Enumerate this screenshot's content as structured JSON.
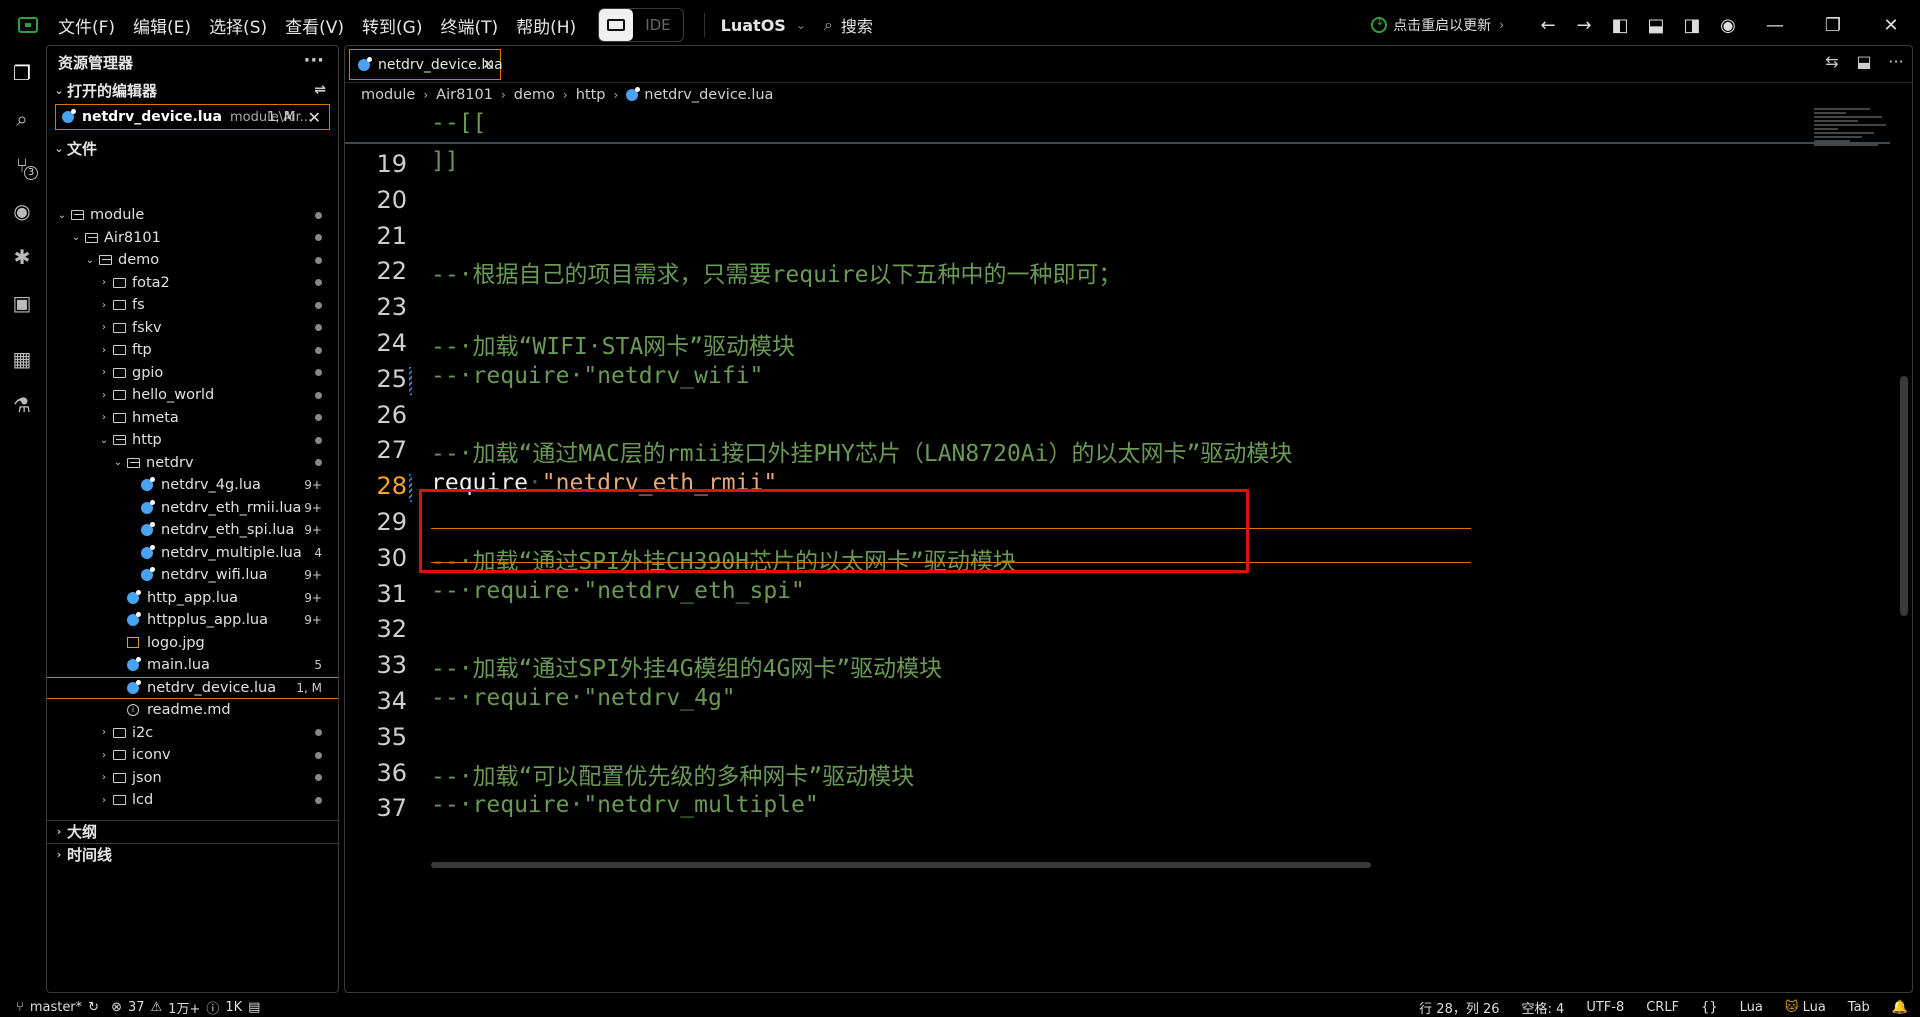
{
  "menu": [
    "文件(F)",
    "编辑(E)",
    "选择(S)",
    "查看(V)",
    "转到(G)",
    "终端(T)",
    "帮助(H)"
  ],
  "ide_label": "IDE",
  "product": "LuatOS",
  "search_label": "搜索",
  "update_label": "点击重启以更新",
  "sidebar": {
    "title": "资源管理器",
    "open_editors": "打开的编辑器",
    "open_file": {
      "name": "netdrv_device.lua",
      "path": "module\\Air...",
      "status": "1, M"
    },
    "files_header": "文件",
    "outline": "大纲",
    "timeline": "时间线"
  },
  "tree": [
    {
      "label": "module",
      "depth": 0,
      "type": "folder",
      "open": true,
      "mark": "dot"
    },
    {
      "label": "Air8101",
      "depth": 1,
      "type": "folder",
      "open": true,
      "mark": "dot"
    },
    {
      "label": "demo",
      "depth": 2,
      "type": "folder",
      "open": true,
      "mark": "dot"
    },
    {
      "label": "fota2",
      "depth": 3,
      "type": "folder",
      "open": false,
      "mark": "dot"
    },
    {
      "label": "fs",
      "depth": 3,
      "type": "folder",
      "open": false,
      "mark": "dot"
    },
    {
      "label": "fskv",
      "depth": 3,
      "type": "folder",
      "open": false,
      "mark": "dot"
    },
    {
      "label": "ftp",
      "depth": 3,
      "type": "folder",
      "open": false,
      "mark": "dot"
    },
    {
      "label": "gpio",
      "depth": 3,
      "type": "folder",
      "open": false,
      "mark": "dot"
    },
    {
      "label": "hello_world",
      "depth": 3,
      "type": "folder",
      "open": false,
      "mark": "dot"
    },
    {
      "label": "hmeta",
      "depth": 3,
      "type": "folder",
      "open": false,
      "mark": "dot"
    },
    {
      "label": "http",
      "depth": 3,
      "type": "folder",
      "open": true,
      "mark": "dot"
    },
    {
      "label": "netdrv",
      "depth": 4,
      "type": "folder",
      "open": true,
      "mark": "dot"
    },
    {
      "label": "netdrv_4g.lua",
      "depth": 5,
      "type": "lua",
      "mark": "9+"
    },
    {
      "label": "netdrv_eth_rmii.lua",
      "depth": 5,
      "type": "lua",
      "mark": "9+"
    },
    {
      "label": "netdrv_eth_spi.lua",
      "depth": 5,
      "type": "lua",
      "mark": "9+"
    },
    {
      "label": "netdrv_multiple.lua",
      "depth": 5,
      "type": "lua",
      "mark": "4"
    },
    {
      "label": "netdrv_wifi.lua",
      "depth": 5,
      "type": "lua",
      "mark": "9+"
    },
    {
      "label": "http_app.lua",
      "depth": 4,
      "type": "lua",
      "mark": "9+"
    },
    {
      "label": "httpplus_app.lua",
      "depth": 4,
      "type": "lua",
      "mark": "9+"
    },
    {
      "label": "logo.jpg",
      "depth": 4,
      "type": "img",
      "mark": ""
    },
    {
      "label": "main.lua",
      "depth": 4,
      "type": "lua",
      "mark": "5"
    },
    {
      "label": "netdrv_device.lua",
      "depth": 4,
      "type": "lua",
      "mark": "1, M",
      "selected": true
    },
    {
      "label": "readme.md",
      "depth": 4,
      "type": "info",
      "mark": ""
    },
    {
      "label": "i2c",
      "depth": 3,
      "type": "folder",
      "open": false,
      "mark": "dot"
    },
    {
      "label": "iconv",
      "depth": 3,
      "type": "folder",
      "open": false,
      "mark": "dot"
    },
    {
      "label": "json",
      "depth": 3,
      "type": "folder",
      "open": false,
      "mark": "dot"
    },
    {
      "label": "lcd",
      "depth": 3,
      "type": "folder",
      "open": false,
      "mark": "dot"
    }
  ],
  "editor": {
    "tab": "netdrv_device.lua",
    "breadcrumbs": [
      "module",
      "Air8101",
      "demo",
      "http",
      "netdrv_device.lua"
    ],
    "sticky": "--[[",
    "lines": [
      {
        "n": "19",
        "text": "]]",
        "kind": "cmt"
      },
      {
        "n": "20",
        "text": "",
        "kind": "cmt"
      },
      {
        "n": "21",
        "text": "",
        "kind": "cmt"
      },
      {
        "n": "22",
        "text": "--·根据自己的项目需求，只需要require以下五种中的一种即可；",
        "kind": "cmt"
      },
      {
        "n": "23",
        "text": "",
        "kind": "cmt"
      },
      {
        "n": "24",
        "text": "--·加载“WIFI·STA网卡”驱动模块",
        "kind": "cmt"
      },
      {
        "n": "25",
        "text": "--·require·\"netdrv_wifi\"",
        "kind": "cmt"
      },
      {
        "n": "26",
        "text": "",
        "kind": "cmt"
      },
      {
        "n": "27",
        "text": "--·加载“通过MAC层的rmii接口外挂PHY芯片（LAN8720Ai）的以太网卡”驱动模块",
        "kind": "cmt"
      },
      {
        "n": "28",
        "kw": "require",
        "str": "\"netdrv_eth_rmii\"",
        "kind": "code"
      },
      {
        "n": "29",
        "text": "",
        "kind": "cmt"
      },
      {
        "n": "30",
        "text": "--·加载“通过SPI外挂CH390H芯片的以太网卡”驱动模块",
        "kind": "cmt"
      },
      {
        "n": "31",
        "text": "--·require·\"netdrv_eth_spi\"",
        "kind": "cmt"
      },
      {
        "n": "32",
        "text": "",
        "kind": "cmt"
      },
      {
        "n": "33",
        "text": "--·加载“通过SPI外挂4G模组的4G网卡”驱动模块",
        "kind": "cmt"
      },
      {
        "n": "34",
        "text": "--·require·\"netdrv_4g\"",
        "kind": "cmt"
      },
      {
        "n": "35",
        "text": "",
        "kind": "cmt"
      },
      {
        "n": "36",
        "text": "--·加载“可以配置优先级的多种网卡”驱动模块",
        "kind": "cmt"
      },
      {
        "n": "37",
        "text": "--·require·\"netdrv_multiple\"",
        "kind": "cmt"
      }
    ]
  },
  "status": {
    "branch": "master*",
    "errors": "37",
    "warnings": "1万+",
    "infos": "1K",
    "position": "行 28，列 26",
    "spaces": "空格: 4",
    "encoding": "UTF-8",
    "eol": "CRLF",
    "braces": "{}",
    "language": "Lua",
    "lua_ext": "Lua",
    "tab": "Tab"
  }
}
